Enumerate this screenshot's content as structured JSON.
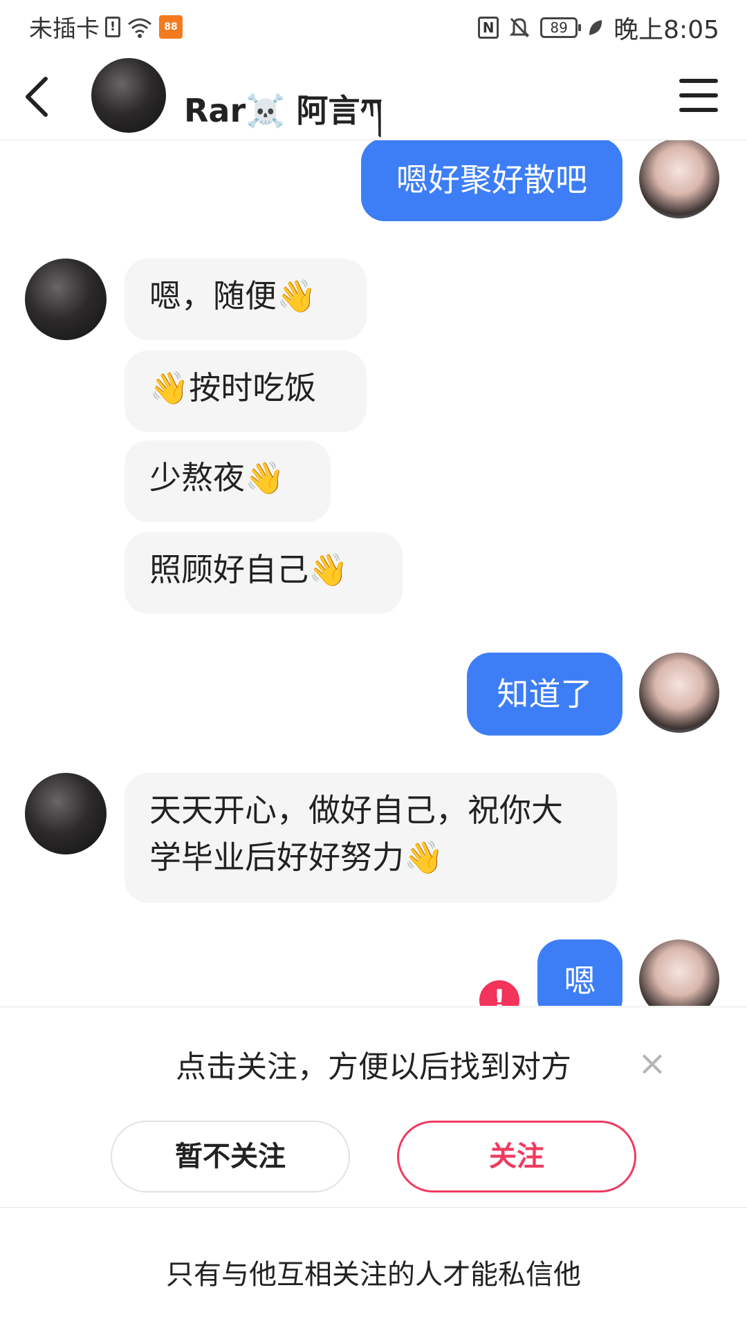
{
  "status_bar": {
    "carrier": "未插卡",
    "app_icon_text": "88",
    "battery": "89",
    "nfc": "N",
    "time": "晚上8:05"
  },
  "header": {
    "contact_name": "Rar☠️ 阿言ཀ"
  },
  "messages": [
    {
      "side": "out",
      "text": "嗯好聚好散吧"
    },
    {
      "side": "in",
      "text": "嗯，随便👋"
    },
    {
      "side": "in",
      "text": "👋按时吃饭"
    },
    {
      "side": "in",
      "text": "少熬夜👋"
    },
    {
      "side": "in",
      "text": "照顾好自己👋"
    },
    {
      "side": "out",
      "text": "知道了"
    },
    {
      "side": "in",
      "text": "天天开心，做好自己，祝你大学毕业后好好努力👋"
    },
    {
      "side": "out",
      "text": "嗯",
      "error": "!"
    }
  ],
  "follow_panel": {
    "prompt": "点击关注，方便以后找到对方",
    "close": "×",
    "not_now_label": "暂不关注",
    "follow_label": "关注"
  },
  "notice": "只有与他互相关注的人才能私信他",
  "colors": {
    "outgoing_bubble": "#3d7ef7",
    "incoming_bubble": "#f5f5f5",
    "follow_accent": "#f03a5f"
  }
}
